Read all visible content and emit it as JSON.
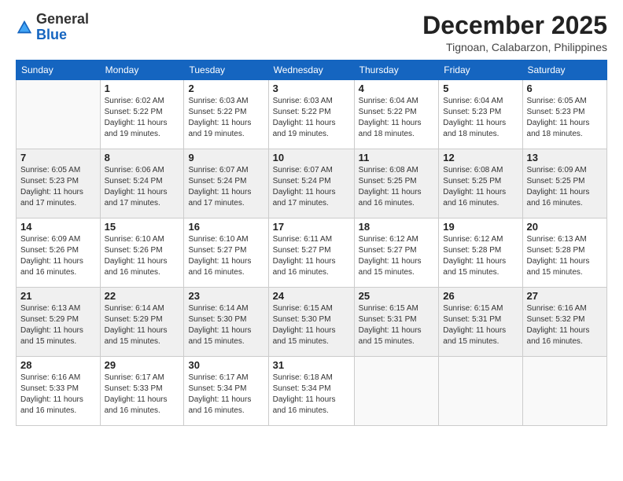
{
  "logo": {
    "general": "General",
    "blue": "Blue"
  },
  "header": {
    "month": "December 2025",
    "location": "Tignoan, Calabarzon, Philippines"
  },
  "weekdays": [
    "Sunday",
    "Monday",
    "Tuesday",
    "Wednesday",
    "Thursday",
    "Friday",
    "Saturday"
  ],
  "weeks": [
    [
      {
        "day": "",
        "sunrise": "",
        "sunset": "",
        "daylight": ""
      },
      {
        "day": "1",
        "sunrise": "Sunrise: 6:02 AM",
        "sunset": "Sunset: 5:22 PM",
        "daylight": "Daylight: 11 hours and 19 minutes."
      },
      {
        "day": "2",
        "sunrise": "Sunrise: 6:03 AM",
        "sunset": "Sunset: 5:22 PM",
        "daylight": "Daylight: 11 hours and 19 minutes."
      },
      {
        "day": "3",
        "sunrise": "Sunrise: 6:03 AM",
        "sunset": "Sunset: 5:22 PM",
        "daylight": "Daylight: 11 hours and 19 minutes."
      },
      {
        "day": "4",
        "sunrise": "Sunrise: 6:04 AM",
        "sunset": "Sunset: 5:22 PM",
        "daylight": "Daylight: 11 hours and 18 minutes."
      },
      {
        "day": "5",
        "sunrise": "Sunrise: 6:04 AM",
        "sunset": "Sunset: 5:23 PM",
        "daylight": "Daylight: 11 hours and 18 minutes."
      },
      {
        "day": "6",
        "sunrise": "Sunrise: 6:05 AM",
        "sunset": "Sunset: 5:23 PM",
        "daylight": "Daylight: 11 hours and 18 minutes."
      }
    ],
    [
      {
        "day": "7",
        "sunrise": "Sunrise: 6:05 AM",
        "sunset": "Sunset: 5:23 PM",
        "daylight": "Daylight: 11 hours and 17 minutes."
      },
      {
        "day": "8",
        "sunrise": "Sunrise: 6:06 AM",
        "sunset": "Sunset: 5:24 PM",
        "daylight": "Daylight: 11 hours and 17 minutes."
      },
      {
        "day": "9",
        "sunrise": "Sunrise: 6:07 AM",
        "sunset": "Sunset: 5:24 PM",
        "daylight": "Daylight: 11 hours and 17 minutes."
      },
      {
        "day": "10",
        "sunrise": "Sunrise: 6:07 AM",
        "sunset": "Sunset: 5:24 PM",
        "daylight": "Daylight: 11 hours and 17 minutes."
      },
      {
        "day": "11",
        "sunrise": "Sunrise: 6:08 AM",
        "sunset": "Sunset: 5:25 PM",
        "daylight": "Daylight: 11 hours and 16 minutes."
      },
      {
        "day": "12",
        "sunrise": "Sunrise: 6:08 AM",
        "sunset": "Sunset: 5:25 PM",
        "daylight": "Daylight: 11 hours and 16 minutes."
      },
      {
        "day": "13",
        "sunrise": "Sunrise: 6:09 AM",
        "sunset": "Sunset: 5:25 PM",
        "daylight": "Daylight: 11 hours and 16 minutes."
      }
    ],
    [
      {
        "day": "14",
        "sunrise": "Sunrise: 6:09 AM",
        "sunset": "Sunset: 5:26 PM",
        "daylight": "Daylight: 11 hours and 16 minutes."
      },
      {
        "day": "15",
        "sunrise": "Sunrise: 6:10 AM",
        "sunset": "Sunset: 5:26 PM",
        "daylight": "Daylight: 11 hours and 16 minutes."
      },
      {
        "day": "16",
        "sunrise": "Sunrise: 6:10 AM",
        "sunset": "Sunset: 5:27 PM",
        "daylight": "Daylight: 11 hours and 16 minutes."
      },
      {
        "day": "17",
        "sunrise": "Sunrise: 6:11 AM",
        "sunset": "Sunset: 5:27 PM",
        "daylight": "Daylight: 11 hours and 16 minutes."
      },
      {
        "day": "18",
        "sunrise": "Sunrise: 6:12 AM",
        "sunset": "Sunset: 5:27 PM",
        "daylight": "Daylight: 11 hours and 15 minutes."
      },
      {
        "day": "19",
        "sunrise": "Sunrise: 6:12 AM",
        "sunset": "Sunset: 5:28 PM",
        "daylight": "Daylight: 11 hours and 15 minutes."
      },
      {
        "day": "20",
        "sunrise": "Sunrise: 6:13 AM",
        "sunset": "Sunset: 5:28 PM",
        "daylight": "Daylight: 11 hours and 15 minutes."
      }
    ],
    [
      {
        "day": "21",
        "sunrise": "Sunrise: 6:13 AM",
        "sunset": "Sunset: 5:29 PM",
        "daylight": "Daylight: 11 hours and 15 minutes."
      },
      {
        "day": "22",
        "sunrise": "Sunrise: 6:14 AM",
        "sunset": "Sunset: 5:29 PM",
        "daylight": "Daylight: 11 hours and 15 minutes."
      },
      {
        "day": "23",
        "sunrise": "Sunrise: 6:14 AM",
        "sunset": "Sunset: 5:30 PM",
        "daylight": "Daylight: 11 hours and 15 minutes."
      },
      {
        "day": "24",
        "sunrise": "Sunrise: 6:15 AM",
        "sunset": "Sunset: 5:30 PM",
        "daylight": "Daylight: 11 hours and 15 minutes."
      },
      {
        "day": "25",
        "sunrise": "Sunrise: 6:15 AM",
        "sunset": "Sunset: 5:31 PM",
        "daylight": "Daylight: 11 hours and 15 minutes."
      },
      {
        "day": "26",
        "sunrise": "Sunrise: 6:15 AM",
        "sunset": "Sunset: 5:31 PM",
        "daylight": "Daylight: 11 hours and 15 minutes."
      },
      {
        "day": "27",
        "sunrise": "Sunrise: 6:16 AM",
        "sunset": "Sunset: 5:32 PM",
        "daylight": "Daylight: 11 hours and 16 minutes."
      }
    ],
    [
      {
        "day": "28",
        "sunrise": "Sunrise: 6:16 AM",
        "sunset": "Sunset: 5:33 PM",
        "daylight": "Daylight: 11 hours and 16 minutes."
      },
      {
        "day": "29",
        "sunrise": "Sunrise: 6:17 AM",
        "sunset": "Sunset: 5:33 PM",
        "daylight": "Daylight: 11 hours and 16 minutes."
      },
      {
        "day": "30",
        "sunrise": "Sunrise: 6:17 AM",
        "sunset": "Sunset: 5:34 PM",
        "daylight": "Daylight: 11 hours and 16 minutes."
      },
      {
        "day": "31",
        "sunrise": "Sunrise: 6:18 AM",
        "sunset": "Sunset: 5:34 PM",
        "daylight": "Daylight: 11 hours and 16 minutes."
      },
      {
        "day": "",
        "sunrise": "",
        "sunset": "",
        "daylight": ""
      },
      {
        "day": "",
        "sunrise": "",
        "sunset": "",
        "daylight": ""
      },
      {
        "day": "",
        "sunrise": "",
        "sunset": "",
        "daylight": ""
      }
    ]
  ]
}
